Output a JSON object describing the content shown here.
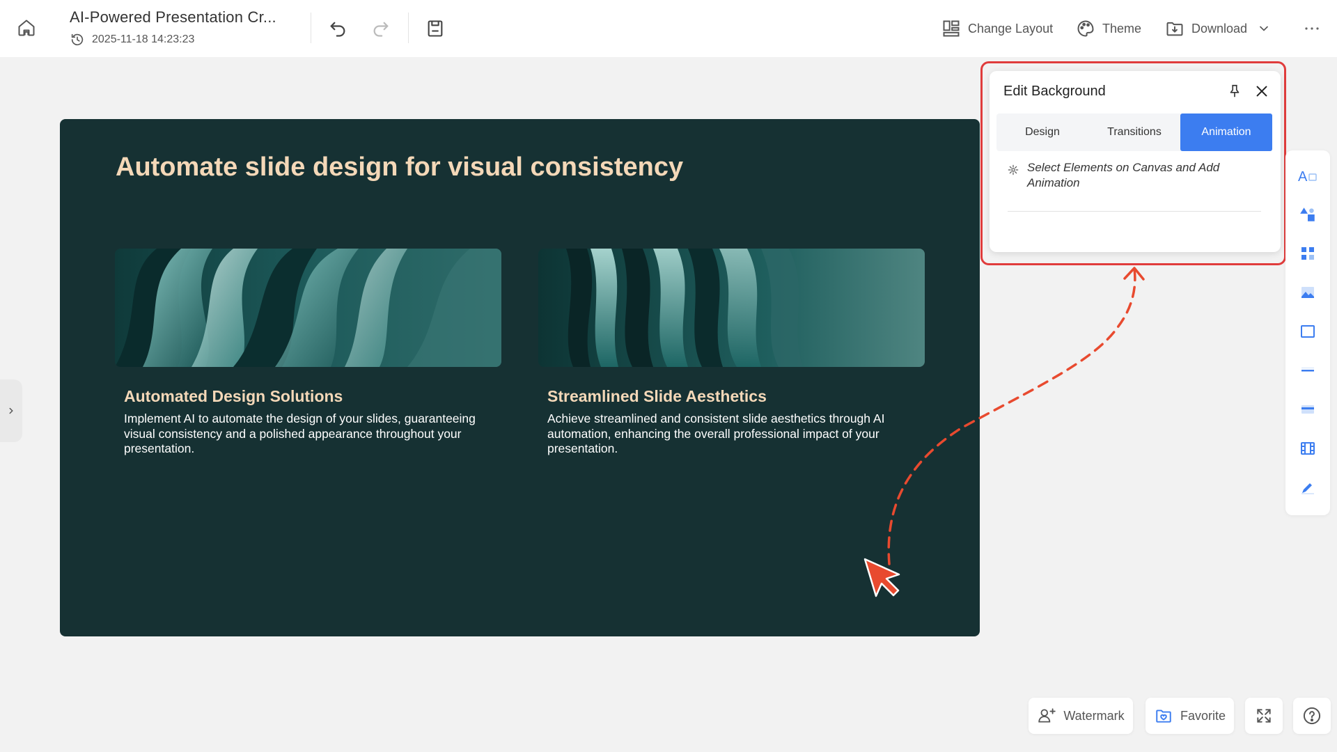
{
  "header": {
    "doc_title": "AI-Powered Presentation Cr...",
    "timestamp": "2025-11-18 14:23:23",
    "actions": {
      "change_layout": "Change Layout",
      "theme": "Theme",
      "download": "Download"
    }
  },
  "slide": {
    "title": "Automate slide design for visual consistency",
    "cards": [
      {
        "heading": "Automated Design Solutions",
        "body": "Implement AI to automate the design of your slides, guaranteeing visual consistency and a polished appearance throughout your presentation."
      },
      {
        "heading": "Streamlined Slide Aesthetics",
        "body": "Achieve streamlined and consistent slide aesthetics through AI automation, enhancing the overall professional impact of your presentation."
      }
    ]
  },
  "panel": {
    "title": "Edit Background",
    "tabs": [
      "Design",
      "Transitions",
      "Animation"
    ],
    "active_tab": "Animation",
    "hint": "Select Elements on Canvas and Add Animation"
  },
  "right_toolbar": {
    "icons": [
      "text-icon",
      "shapes-icon",
      "elements-icon",
      "image-icon",
      "frame-icon",
      "line-icon",
      "table-bar-icon",
      "video-icon",
      "draw-icon"
    ]
  },
  "bottom": {
    "watermark": "Watermark",
    "favorite": "Favorite"
  },
  "colors": {
    "slide_bg": "#163133",
    "slide_heading": "#f4d8b8",
    "accent_blue": "#3c7df0",
    "annotation_red": "#e03c3c"
  }
}
